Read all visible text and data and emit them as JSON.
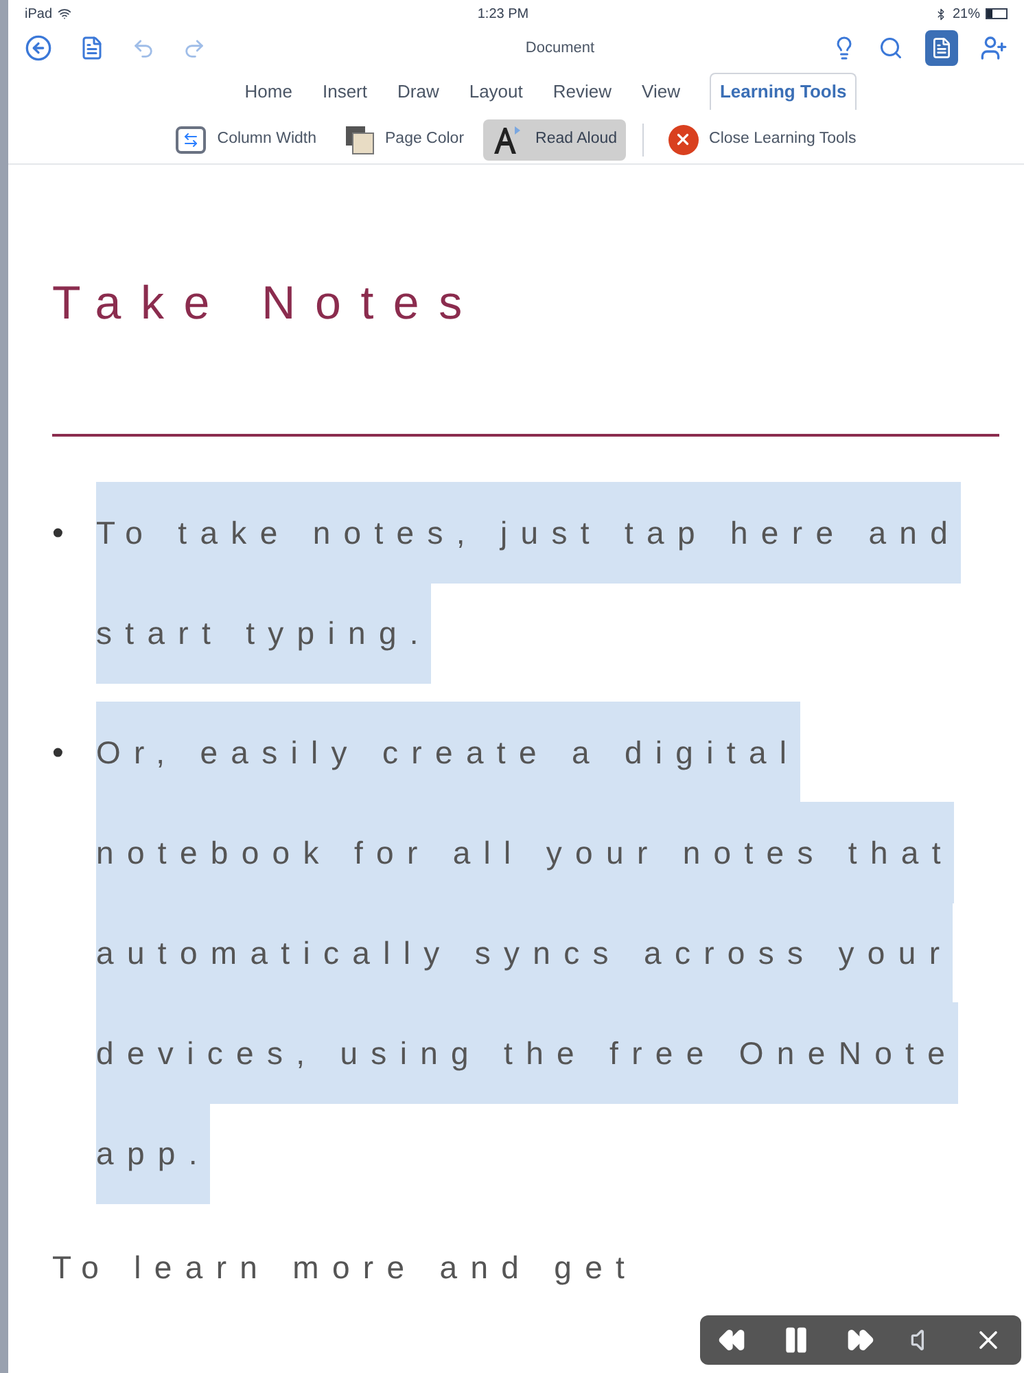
{
  "status_bar": {
    "device": "iPad",
    "time": "1:23 PM",
    "battery": "21%"
  },
  "window": {
    "title": "Document"
  },
  "tabs": [
    {
      "label": "Home",
      "selected": false
    },
    {
      "label": "Insert",
      "selected": false
    },
    {
      "label": "Draw",
      "selected": false
    },
    {
      "label": "Layout",
      "selected": false
    },
    {
      "label": "Review",
      "selected": false
    },
    {
      "label": "View",
      "selected": false
    },
    {
      "label": "Learning Tools",
      "selected": true
    }
  ],
  "ribbon": [
    {
      "kind": "column",
      "label": "Column Width",
      "selected": false
    },
    {
      "kind": "page",
      "label": "Page Color",
      "selected": false
    },
    {
      "kind": "read",
      "label": "Read Aloud",
      "selected": true
    },
    {
      "kind": "close",
      "label": "Close Learning Tools",
      "selected": false
    }
  ],
  "document": {
    "heading": "Take Notes",
    "bullets": [
      {
        "marker": "•",
        "text": "To take notes, just tap here and start typing.",
        "highlighted": true
      },
      {
        "marker": "•",
        "text": "Or, easily create a digital notebook for all your notes that automatically syncs across your devices, using the free OneNote app.",
        "highlighted": true
      }
    ],
    "paragraph": "To learn more and get"
  }
}
